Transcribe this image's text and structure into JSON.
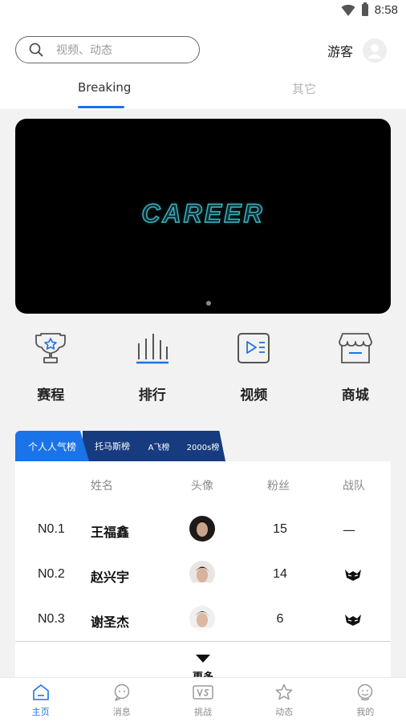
{
  "status_bar": {
    "time": "8:58"
  },
  "search": {
    "placeholder": "视频、动态"
  },
  "user": {
    "label": "游客"
  },
  "tabs": [
    {
      "label": "Breaking",
      "active": true
    },
    {
      "label": "其它",
      "active": false
    }
  ],
  "banner": {
    "text": "CAREER"
  },
  "shortcuts": [
    {
      "label": "赛程",
      "icon": "trophy-icon"
    },
    {
      "label": "排行",
      "icon": "ranking-bars-icon"
    },
    {
      "label": "视频",
      "icon": "video-play-icon"
    },
    {
      "label": "商城",
      "icon": "store-icon"
    }
  ],
  "rank_tabs": [
    {
      "label": "个人人气榜",
      "active": true
    },
    {
      "label": "托马斯榜",
      "active": false
    },
    {
      "label": "A飞榜",
      "active": false
    },
    {
      "label": "2000s榜",
      "active": false
    }
  ],
  "ranking": {
    "headers": {
      "name": "姓名",
      "avatar": "头像",
      "fans": "粉丝",
      "team": "战队"
    },
    "rows": [
      {
        "rank": "N0.1",
        "name": "王福鑫",
        "fans": "15",
        "team": "—",
        "team_icon": null
      },
      {
        "rank": "N0.2",
        "name": "赵兴宇",
        "fans": "14",
        "team": "",
        "team_icon": "team-logo-icon"
      },
      {
        "rank": "N0.3",
        "name": "谢圣杰",
        "fans": "6",
        "team": "",
        "team_icon": "team-logo-icon"
      }
    ],
    "more_label": "更多"
  },
  "bottom_nav": [
    {
      "label": "主页",
      "icon": "home-icon",
      "active": true
    },
    {
      "label": "消息",
      "icon": "message-icon",
      "active": false
    },
    {
      "label": "挑战",
      "icon": "vs-icon",
      "active": false
    },
    {
      "label": "动态",
      "icon": "star-icon",
      "active": false
    },
    {
      "label": "我的",
      "icon": "profile-icon",
      "active": false
    }
  ],
  "colors": {
    "accent": "#1a73e8",
    "rank_tab_inactive": "#173b7f",
    "banner_logo": "#3fb6c4"
  }
}
